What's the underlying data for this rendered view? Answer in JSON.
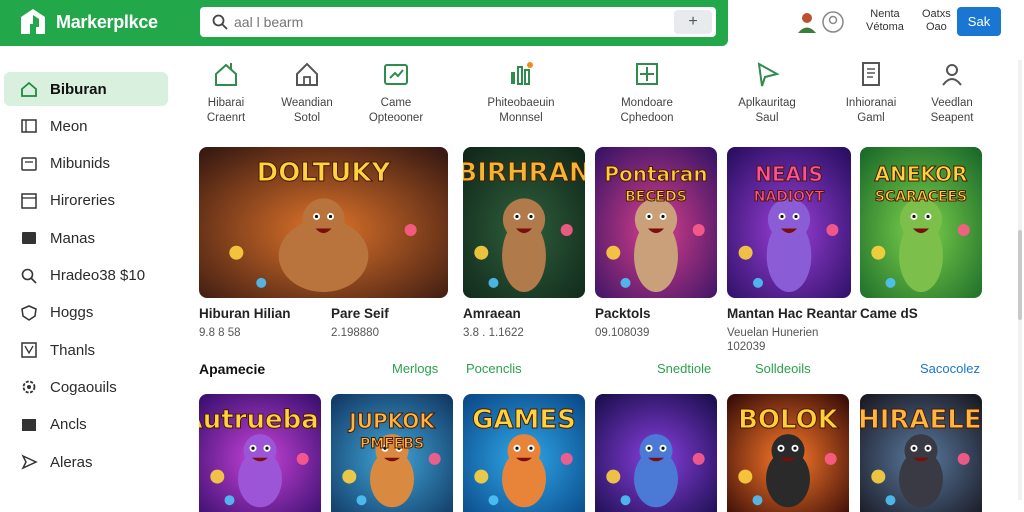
{
  "header": {
    "brand": "Markerplkce",
    "search_placeholder": "aal l bearm",
    "search_button": "+",
    "account_line1": "Nenta",
    "account_line2": "Vétoma",
    "status_line1": "Oatxs",
    "status_line2": "Oao",
    "cta": "Sak",
    "brand_color": "#22a84a",
    "cta_color": "#1976d2"
  },
  "sidebar": {
    "items": [
      {
        "label": "Biburan",
        "icon": "home-icon",
        "active": true
      },
      {
        "label": "Meon",
        "icon": "grid-icon"
      },
      {
        "label": "Mibunids",
        "icon": "square-icon"
      },
      {
        "label": "Hiroreries",
        "icon": "frame-icon"
      },
      {
        "label": "Manas",
        "icon": "card-icon"
      },
      {
        "label": "Hradeo38 $10",
        "icon": "search-icon"
      },
      {
        "label": "Hoggs",
        "icon": "shield-icon"
      },
      {
        "label": "Thanls",
        "icon": "flag-icon"
      },
      {
        "label": "Cogaouils",
        "icon": "gear-icon"
      },
      {
        "label": "Ancls",
        "icon": "block-icon"
      },
      {
        "label": "Aleras",
        "icon": "send-icon"
      }
    ]
  },
  "categories": [
    {
      "line1": "Hibarai",
      "line2": "Craenrt",
      "icon": "home-plus-icon"
    },
    {
      "line1": "Weandian",
      "line2": "Sotol",
      "icon": "house-icon"
    },
    {
      "line1": "Came",
      "line2": "Opteooner",
      "icon": "chart-icon"
    },
    {
      "line1": "Phiteobaeuin",
      "line2": "Monnsel",
      "icon": "bars-icon"
    },
    {
      "line1": "Mondoare",
      "line2": "Cphedoon",
      "icon": "plus-box-icon"
    },
    {
      "line1": "Aplkauritag",
      "line2": "Saul",
      "icon": "arrow-icon"
    },
    {
      "line1": "Inhioranai",
      "line2": "Gaml",
      "icon": "document-icon"
    },
    {
      "line1": "Veedlan",
      "line2": "Seapent",
      "icon": "user-icon"
    }
  ],
  "row1": [
    {
      "title": "Hiburan Hilian",
      "sub": "9.8 8 58"
    },
    {
      "title": "Pare Seif",
      "sub": "2.198880"
    },
    {
      "title": "Amraean",
      "sub": "3.8 . 1.1622"
    },
    {
      "title": "Packtols",
      "sub": "09.108039"
    },
    {
      "title": "Mantan Hac Reantar",
      "sub": "Veuelan Hunerien",
      "sub2": "102039"
    },
    {
      "title": "Came dS",
      "sub": ""
    }
  ],
  "row1_art": [
    "DOLTUKY",
    "BIRHRAN",
    "Pontaran\nBECEDS",
    "NEAIS\nNADIOYT",
    "ANEKOR\nSCARACEES"
  ],
  "section": {
    "title": "Apamecie",
    "links": [
      "Merlogs",
      "Pocenclis",
      "Snedtiole",
      "Solldeoils",
      "Sacocolez"
    ]
  },
  "row2_art": [
    "Autrueban",
    "JUPKOK\nPMFEBS",
    "GAMES",
    "",
    "BOLOK",
    "THIRAELEK"
  ]
}
